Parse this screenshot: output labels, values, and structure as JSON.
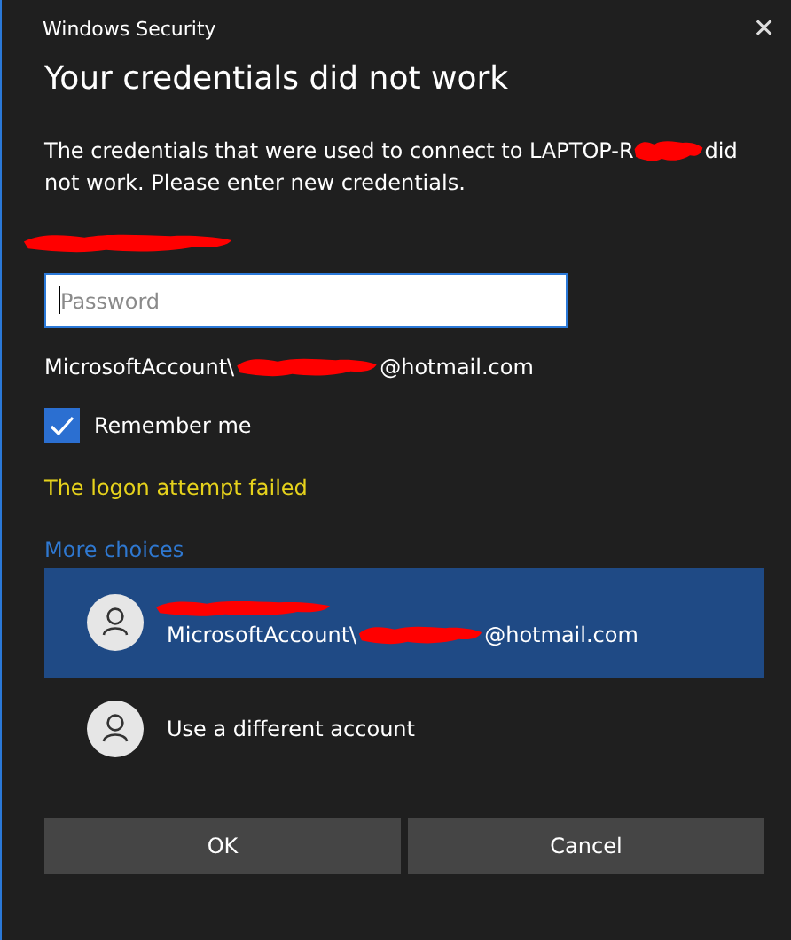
{
  "window": {
    "title": "Windows Security",
    "close": "✕"
  },
  "heading": "Your credentials did not work",
  "message": {
    "before": "The credentials that were used to connect to LAPTOP-R",
    "after": "did",
    "line2": "not work. Please enter new credentials."
  },
  "password": {
    "placeholder": "Password",
    "focused": true
  },
  "account": {
    "prefix": "MicrosoftAccount\\",
    "suffix": "@hotmail.com"
  },
  "remember": {
    "label": "Remember me",
    "checked": true
  },
  "error": "The logon attempt failed",
  "more_choices": "More choices",
  "choices": [
    {
      "kind": "account",
      "selected": true,
      "prefix": "MicrosoftAccount\\",
      "suffix": "@hotmail.com"
    },
    {
      "kind": "option",
      "selected": false,
      "label": "Use a different account"
    }
  ],
  "buttons": [
    "OK",
    "Cancel"
  ]
}
